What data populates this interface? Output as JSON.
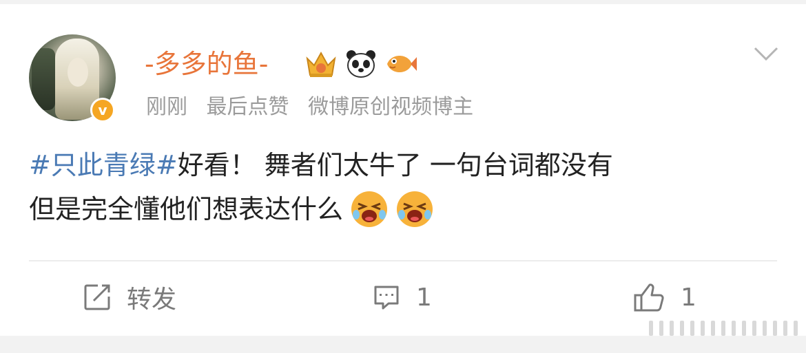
{
  "post": {
    "author": {
      "name": "-多多的鱼-",
      "verified": true,
      "badges": [
        "crown-badge-icon",
        "panda-badge-icon",
        "fish-badge-icon"
      ]
    },
    "meta": {
      "time": "刚刚",
      "activity": "最后点赞",
      "title": "微博原创视频博主"
    },
    "content": {
      "hashtag": "#只此青绿#",
      "line1_text": "好看！ 舞者们太牛了 一句台词都没有",
      "line2_text": "但是完全懂他们想表达什么",
      "emojis": [
        "crying-laugh-emoji",
        "crying-laugh-emoji"
      ]
    },
    "actions": {
      "repost_label": "转发",
      "comment_count": "1",
      "like_count": "1"
    }
  },
  "colors": {
    "username": "#e8753a",
    "hashtag": "#4a7ab4",
    "meta": "#9b9b9b",
    "text": "#222222",
    "action": "#7a7a7a",
    "verified": "#f5a623"
  }
}
